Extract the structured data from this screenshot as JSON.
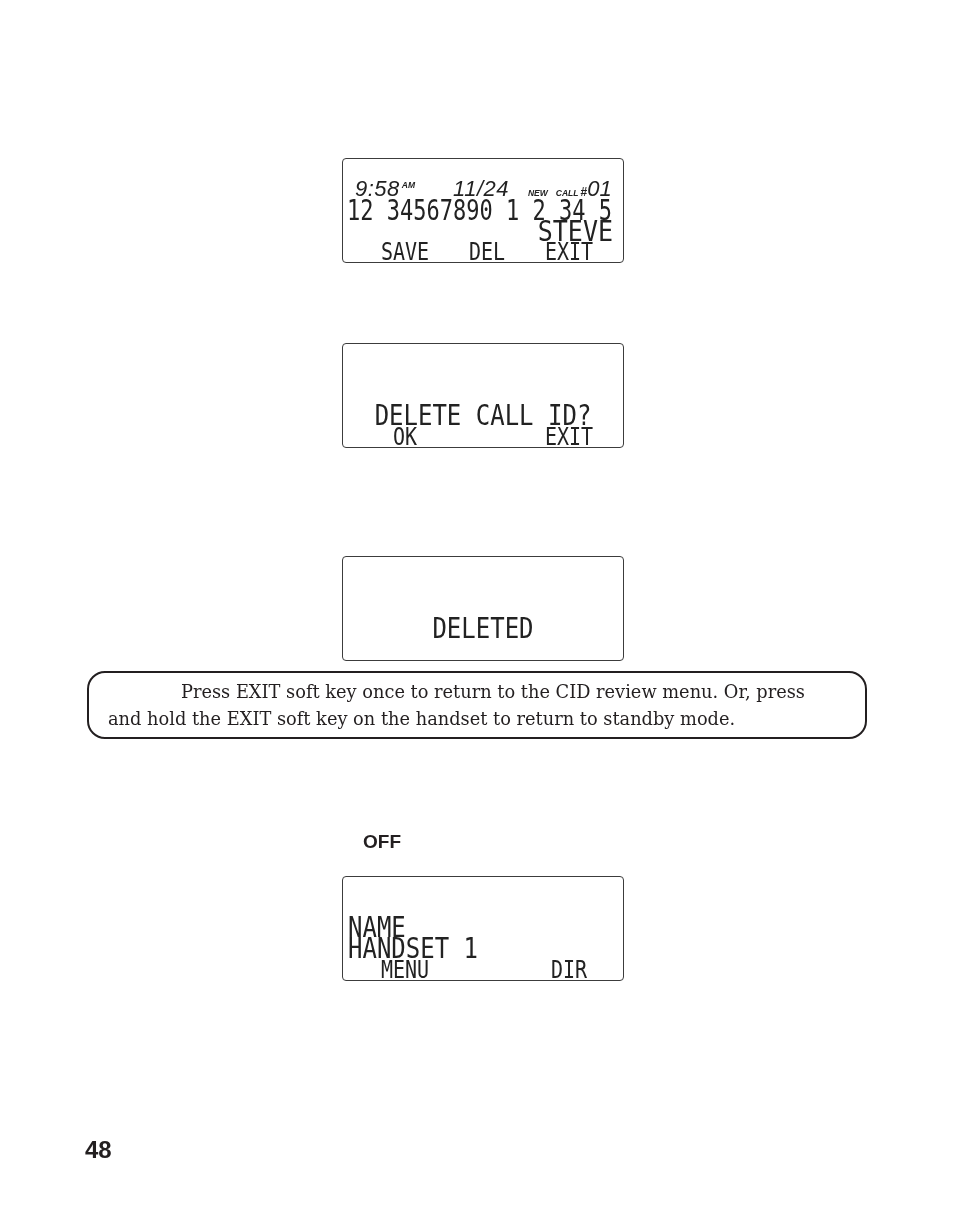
{
  "content": [
    {
      "kind": "call_record_screen",
      "time": "9:58",
      "meridiem": "AM",
      "date": "11/24",
      "new_label": "NEW",
      "call_label": "CALL",
      "number_sign": "#",
      "call_number": "01",
      "phone_number": "12 34567890 1 2 34 5",
      "caller_name": "STEVE",
      "soft_keys": [
        "SAVE",
        "DEL",
        "EXIT"
      ]
    },
    {
      "kind": "message_screen",
      "lines": [
        "DELETE CALL ID?"
      ],
      "soft_keys": [
        "OK",
        "EXIT"
      ]
    },
    {
      "kind": "message_screen",
      "lines": [
        "DELETED"
      ]
    },
    {
      "kind": "note",
      "text": "Press EXIT soft key once to return to the CID review menu. Or, press and hold the EXIT soft key on the handset to return to standby mode."
    },
    {
      "kind": "key_label",
      "text": "OFF"
    },
    {
      "kind": "standby_screen",
      "lines": [
        "NAME",
        "HANDSET 1"
      ],
      "soft_keys": [
        "MENU",
        "DIR"
      ]
    },
    {
      "kind": "page_number",
      "text": "48"
    }
  ]
}
